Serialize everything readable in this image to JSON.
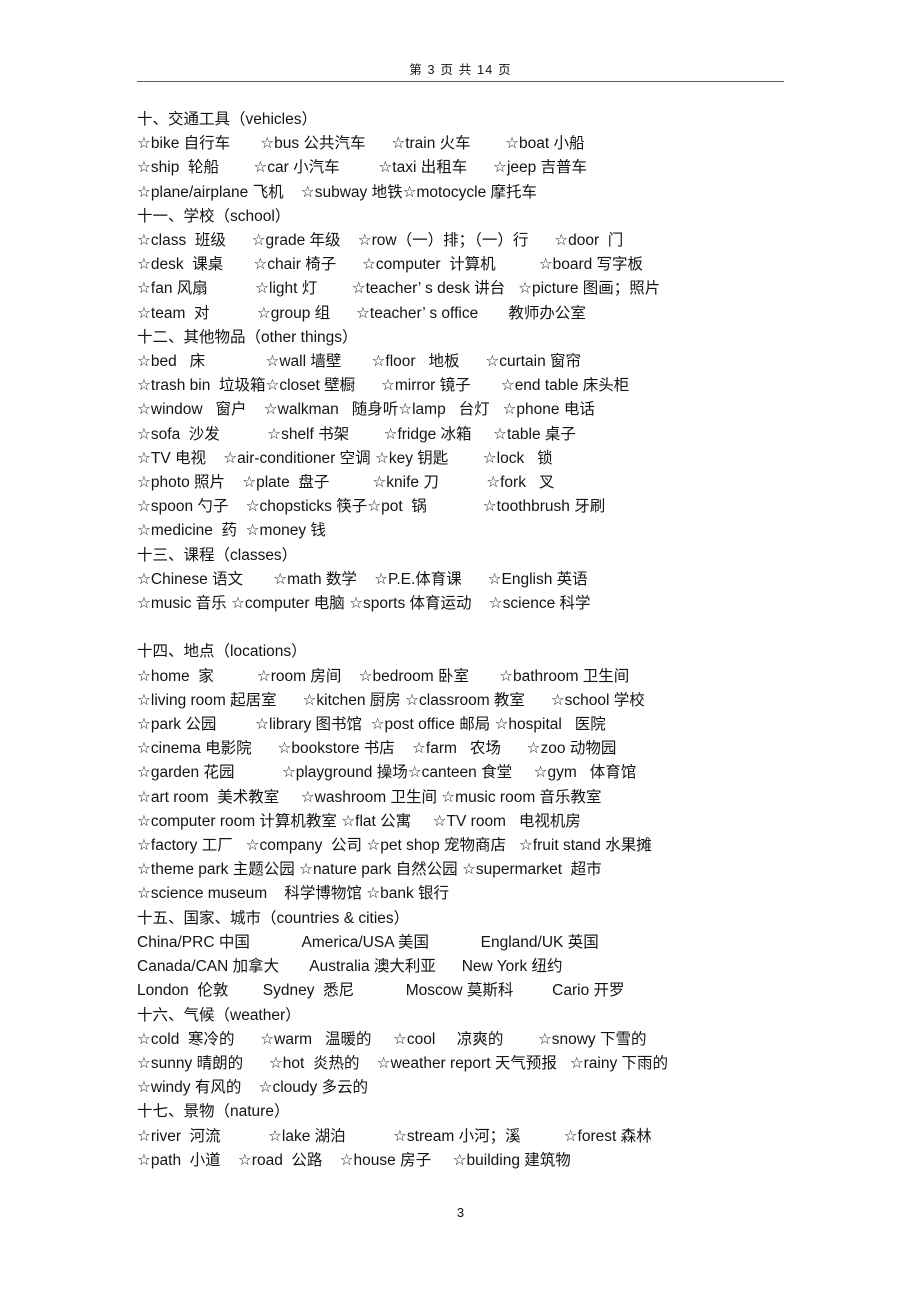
{
  "header": {
    "page_indicator": "第 3 页 共 14 页"
  },
  "footer": {
    "page_number": "3"
  },
  "colors": {
    "text": "#141414",
    "rule": "#5c5c66",
    "background": "#ffffff"
  },
  "sections": [
    {
      "title": "十、交通工具（vehicles）",
      "lines": [
        "☆bike 自行车       ☆bus 公共汽车      ☆train 火车        ☆boat 小船",
        "☆ship  轮船        ☆car 小汽车         ☆taxi 出租车      ☆jeep 吉普车",
        "☆plane/airplane 飞机    ☆subway 地铁☆motocycle 摩托车"
      ]
    },
    {
      "title": "十一、学校（school）",
      "lines": [
        "☆class  班级      ☆grade 年级    ☆row（一）排；（一）行      ☆door  门",
        "☆desk  课桌       ☆chair 椅子      ☆computer  计算机          ☆board 写字板",
        "☆fan 风扇           ☆light 灯        ☆teacher’ s desk 讲台   ☆picture 图画；照片",
        "☆team  对           ☆group 组      ☆teacher’ s office       教师办公室"
      ]
    },
    {
      "title": "十二、其他物品（other things）",
      "lines": [
        "☆bed   床              ☆wall 墙壁       ☆floor   地板      ☆curtain 窗帘",
        "☆trash bin  垃圾箱☆closet 壁橱      ☆mirror 镜子       ☆end table 床头柜",
        "☆window   窗户    ☆walkman   随身听☆lamp   台灯   ☆phone 电话",
        "☆sofa  沙发           ☆shelf 书架        ☆fridge 冰箱     ☆table 桌子",
        "☆TV 电视    ☆air-conditioner 空调 ☆key 钥匙        ☆lock   锁",
        "☆photo 照片    ☆plate  盘子          ☆knife 刀           ☆fork   叉",
        "☆spoon 勺子    ☆chopsticks 筷子☆pot  锅             ☆toothbrush 牙刷",
        "☆medicine  药  ☆money 钱"
      ]
    },
    {
      "title": "十三、课程（classes）",
      "lines": [
        "☆Chinese 语文       ☆math 数学    ☆P.E.体育课      ☆English 英语",
        "☆music 音乐 ☆computer 电脑 ☆sports 体育运动    ☆science 科学"
      ],
      "trailing_blank": true
    },
    {
      "title": "十四、地点（locations）",
      "lines": [
        "☆home  家          ☆room 房间    ☆bedroom 卧室       ☆bathroom 卫生间",
        "☆living room 起居室      ☆kitchen 厨房 ☆classroom 教室      ☆school 学校",
        "☆park 公园         ☆library 图书馆  ☆post office 邮局 ☆hospital   医院",
        "☆cinema 电影院      ☆bookstore 书店    ☆farm   农场      ☆zoo 动物园",
        "☆garden 花园           ☆playground 操场☆canteen 食堂     ☆gym   体育馆",
        "☆art room  美术教室     ☆washroom 卫生间 ☆music room 音乐教室",
        "☆computer room 计算机教室 ☆flat 公寓     ☆TV room   电视机房",
        "☆factory 工厂   ☆company  公司 ☆pet shop 宠物商店   ☆fruit stand 水果摊",
        "☆theme park 主题公园 ☆nature park 自然公园 ☆supermarket  超市",
        "☆science museum    科学博物馆 ☆bank 银行"
      ]
    },
    {
      "title": "十五、国家、城市（countries & cities）",
      "lines": [
        "China/PRC 中国            America/USA 美国            England/UK 英国",
        "Canada/CAN 加拿大       Australia 澳大利亚      New York 纽约",
        "London  伦敦        Sydney  悉尼            Moscow 莫斯科         Cario 开罗"
      ]
    },
    {
      "title": "十六、气候（weather）",
      "lines": [
        "☆cold  寒冷的      ☆warm   温暖的     ☆cool     凉爽的        ☆snowy 下雪的",
        "☆sunny 晴朗的      ☆hot  炎热的    ☆weather report 天气预报   ☆rainy 下雨的",
        "☆windy 有风的    ☆cloudy 多云的"
      ]
    },
    {
      "title": "十七、景物（nature）",
      "lines": [
        "☆river  河流           ☆lake 湖泊           ☆stream 小河；溪          ☆forest 森林",
        "☆path  小道    ☆road  公路    ☆house 房子     ☆building 建筑物"
      ]
    }
  ]
}
